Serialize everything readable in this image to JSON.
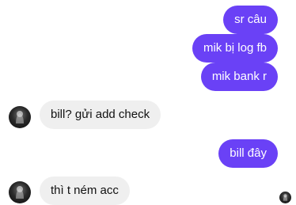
{
  "conversation": {
    "messages": [
      {
        "side": "out",
        "text": "sr câu"
      },
      {
        "side": "out",
        "text": "mik bị log fb"
      },
      {
        "side": "out",
        "text": "mik bank r"
      },
      {
        "side": "in",
        "text": "bill? gửi add check"
      },
      {
        "side": "out",
        "text": "bill đây"
      },
      {
        "side": "in",
        "text": "thì t ném acc"
      }
    ]
  },
  "colors": {
    "outgoing_bubble": "#6a41f6",
    "incoming_bubble": "#efefef",
    "background": "#ffffff"
  }
}
